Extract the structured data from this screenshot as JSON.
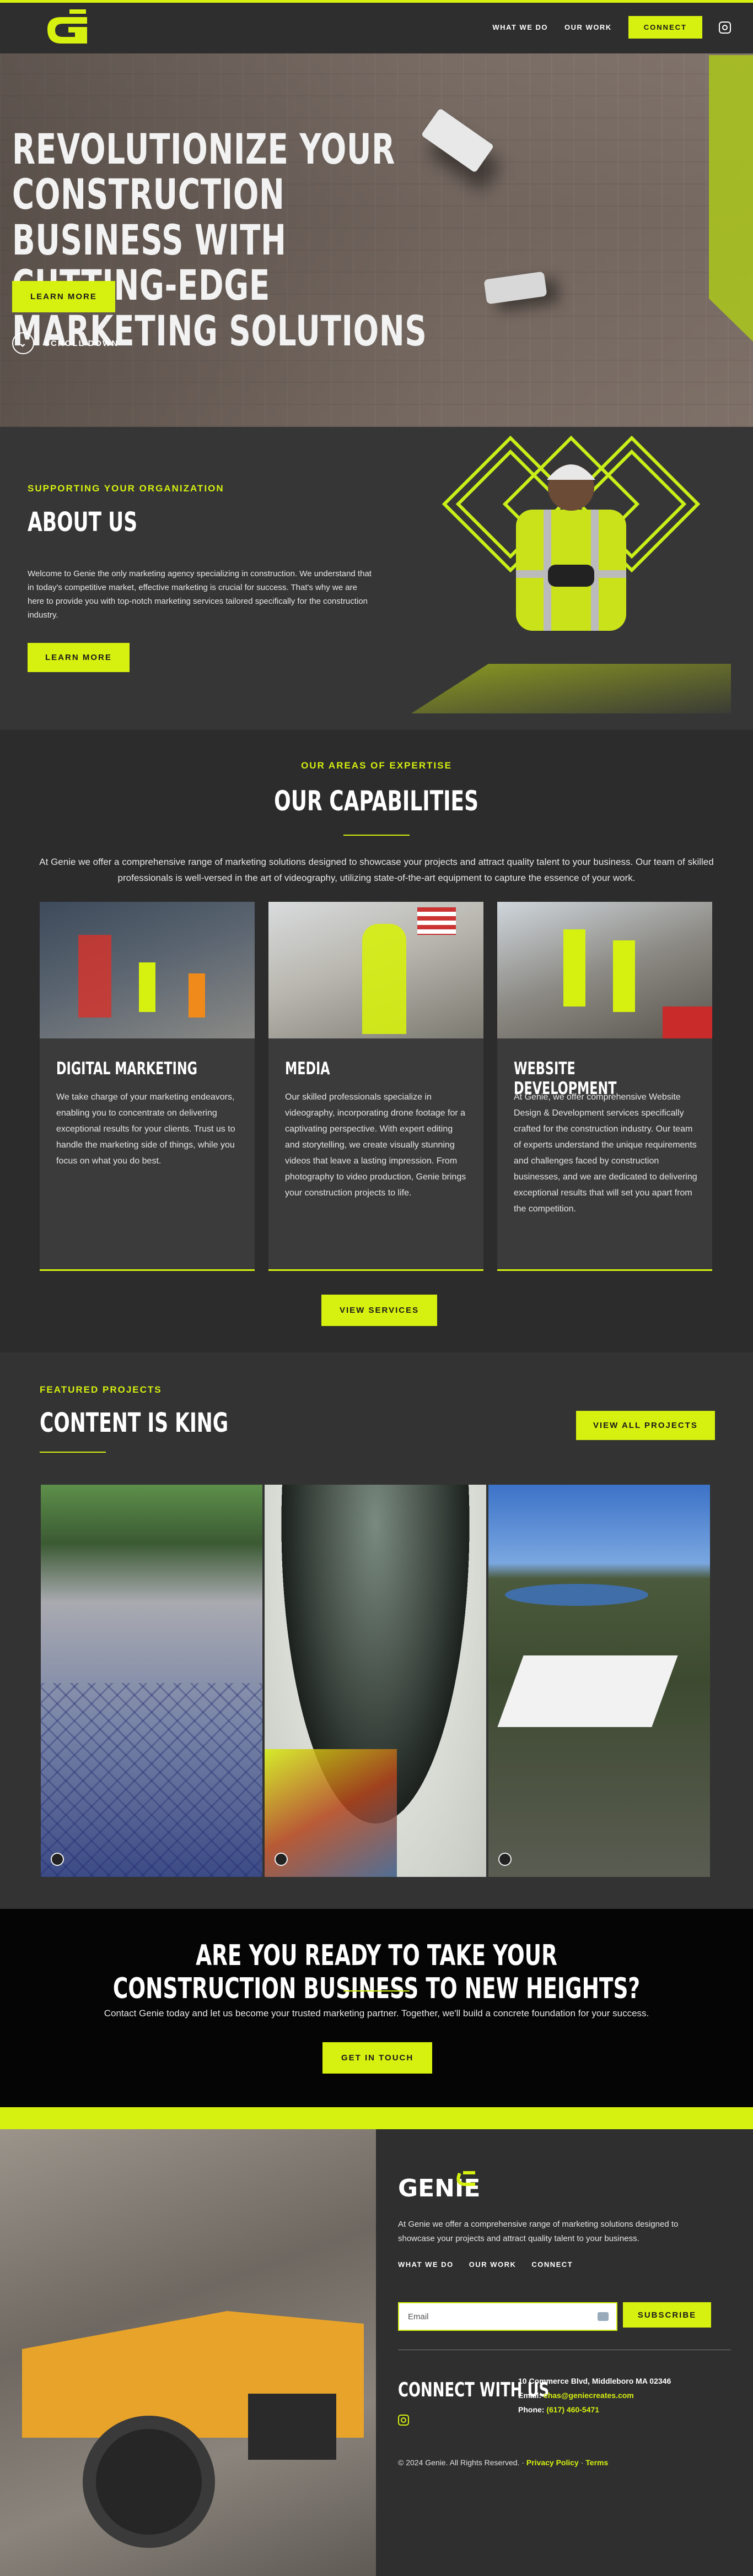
{
  "nav": {
    "logo_text": "GENIE",
    "links": [
      "WHAT WE DO",
      "OUR WORK"
    ],
    "connect_label": "CONNECT",
    "instagram_icon": "instagram-icon"
  },
  "hero": {
    "title_lines": [
      "REVOLUTIONIZE YOUR CONSTRUCTION",
      "BUSINESS WITH CUTTING-EDGE",
      "MARKETING SOLUTIONS"
    ],
    "cta_label": "LEARN MORE",
    "scroll_label": "SCROLL DOWN"
  },
  "about": {
    "kicker": "SUPPORTING YOUR ORGANIZATION",
    "title": "ABOUT US",
    "body": "Welcome to Genie the only marketing agency specializing in construction. We understand that in today's competitive market, effective marketing is crucial for success. That's why we are here to provide you with top-notch marketing services tailored specifically for the construction industry.",
    "cta_label": "LEARN MORE"
  },
  "capabilities": {
    "kicker": "OUR AREAS OF EXPERTISE",
    "title": "OUR CAPABILITIES",
    "intro": "At  Genie we offer a comprehensive range of marketing solutions designed to showcase your projects and attract quality talent to your business. Our team of skilled professionals is well-versed in the art of videography, utilizing state-of-the-art equipment to capture the essence of your work.",
    "cards": [
      {
        "title": "DIGITAL MARKETING",
        "body": "We take charge of your marketing endeavors, enabling you to concentrate on delivering exceptional results for your clients. Trust us to handle the marketing side of things, while you focus on what you do best."
      },
      {
        "title": "MEDIA",
        "body": "Our skilled professionals specialize in videography, incorporating drone footage for a captivating perspective. With expert editing and storytelling, we create visually stunning videos that leave a lasting impression. From photography to video production, Genie brings your construction projects to life."
      },
      {
        "title": "WEBSITE DEVELOPMENT",
        "body": "At Genie, we offer comprehensive Website Design & Development services specifically crafted for the construction industry. Our team of experts understand the unique requirements and challenges faced by construction businesses, and we are dedicated to delivering exceptional results that will set you apart from the competition."
      }
    ],
    "cta_label": "VIEW SERVICES"
  },
  "featured": {
    "kicker": "FEATURED PROJECTS",
    "title": "CONTENT IS KING",
    "cta_label": "VIEW ALL PROJECTS"
  },
  "cta": {
    "title": "ARE YOU READY TO TAKE YOUR CONSTRUCTION BUSINESS TO NEW HEIGHTS?",
    "body": "Contact Genie today and let us become your trusted marketing partner. Together, we'll build a concrete foundation for your success.",
    "cta_label": "GET IN TOUCH"
  },
  "footer": {
    "logo_text": "GENIE",
    "description": "At Genie we offer a comprehensive range of marketing solutions designed to showcase your projects and attract quality talent to your business.",
    "links": [
      "WHAT WE DO",
      "OUR WORK",
      "CONNECT"
    ],
    "email_placeholder": "Email",
    "subscribe_label": "SUBSCRIBE",
    "connect_title": "CONNECT WITH US",
    "address": "10 Commerce Blvd, Middleboro MA 02346",
    "email_label": "Email: ",
    "email_value": "chas@geniecreates.com",
    "phone_label": "Phone: ",
    "phone_value": "(617) 460-5471",
    "copyright": "© 2024 Genie. All Rights Reserved. · ",
    "privacy": "Privacy Policy",
    "sep": " · ",
    "terms": "Terms"
  },
  "colors": {
    "accent": "#d6f00f",
    "dark": "#2b2b2b",
    "black": "#050505"
  }
}
